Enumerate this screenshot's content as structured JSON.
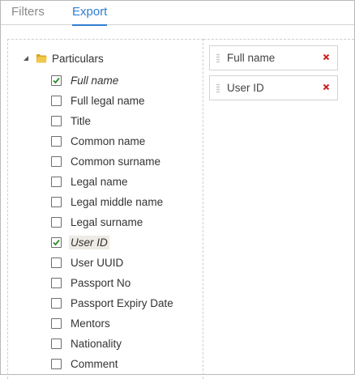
{
  "tabs": [
    {
      "label": "Filters",
      "active": false
    },
    {
      "label": "Export",
      "active": true
    }
  ],
  "tree": {
    "root_label": "Particulars",
    "items": [
      {
        "label": "Full name",
        "checked": true
      },
      {
        "label": "Full legal name",
        "checked": false
      },
      {
        "label": "Title",
        "checked": false
      },
      {
        "label": "Common name",
        "checked": false
      },
      {
        "label": "Common surname",
        "checked": false
      },
      {
        "label": "Legal name",
        "checked": false
      },
      {
        "label": "Legal middle name",
        "checked": false
      },
      {
        "label": "Legal surname",
        "checked": false
      },
      {
        "label": "User ID",
        "checked": true
      },
      {
        "label": "User UUID",
        "checked": false
      },
      {
        "label": "Passport No",
        "checked": false
      },
      {
        "label": "Passport Expiry Date",
        "checked": false
      },
      {
        "label": "Mentors",
        "checked": false
      },
      {
        "label": "Nationality",
        "checked": false
      },
      {
        "label": "Comment",
        "checked": false
      }
    ]
  },
  "selected": [
    {
      "label": "Full name"
    },
    {
      "label": "User ID"
    }
  ],
  "colors": {
    "accent": "#2f7fd1",
    "remove": "#cc2222",
    "checkmark": "#2e8b2e",
    "folder": "#e8b730"
  }
}
